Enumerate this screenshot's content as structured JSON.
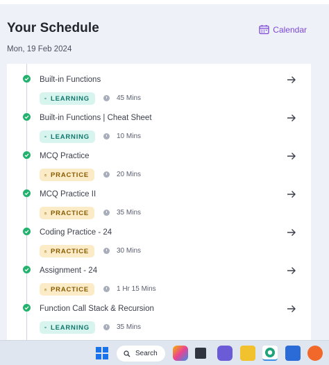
{
  "header": {
    "title": "Your Schedule",
    "date": "Mon, 19 Feb 2024",
    "calendar_label": "Calendar"
  },
  "items": [
    {
      "title": "Built-in Functions",
      "type": "LEARNING",
      "duration": "45 Mins"
    },
    {
      "title": "Built-in Functions | Cheat Sheet",
      "type": "LEARNING",
      "duration": "10 Mins"
    },
    {
      "title": "MCQ Practice",
      "type": "PRACTICE",
      "duration": "20 Mins"
    },
    {
      "title": "MCQ Practice II",
      "type": "PRACTICE",
      "duration": "35 Mins"
    },
    {
      "title": "Coding Practice - 24",
      "type": "PRACTICE",
      "duration": "30 Mins"
    },
    {
      "title": "Assignment - 24",
      "type": "PRACTICE",
      "duration": "1 Hr 15 Mins"
    },
    {
      "title": "Function Call Stack & Recursion",
      "type": "LEARNING",
      "duration": "35 Mins"
    }
  ],
  "taskbar": {
    "search_label": "Search"
  },
  "colors": {
    "accent": "#7c46d9",
    "check": "#23b26d",
    "learning_bg": "#d8f4ef",
    "learning_fg": "#11776b",
    "practice_bg": "#fbecc7",
    "practice_fg": "#8a5a00"
  }
}
